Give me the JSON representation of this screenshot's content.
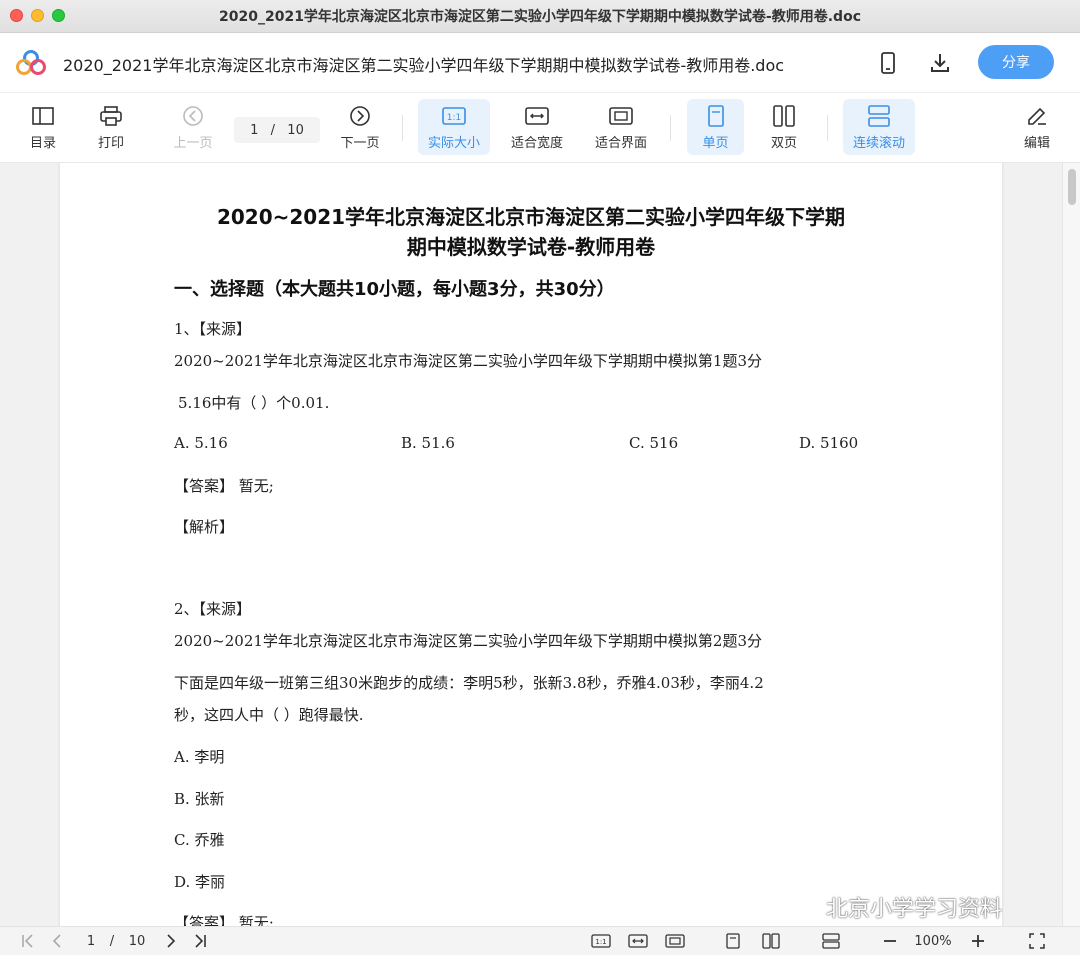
{
  "window": {
    "title": "2020_2021学年北京海淀区北京市海淀区第二实验小学四年级下学期期中模拟数学试卷-教师用卷.doc"
  },
  "header": {
    "doc_title": "2020_2021学年北京海淀区北京市海淀区第二实验小学四年级下学期期中模拟数学试卷-教师用卷.doc",
    "share_label": "分享",
    "accent": "#4d9ef5"
  },
  "toolbar": {
    "toc": "目录",
    "print": "打印",
    "prev": "上一页",
    "current_page": "1",
    "page_sep": "/",
    "total_pages": "10",
    "next": "下一页",
    "actual_size": "实际大小",
    "actual_size_icon": "1:1",
    "fit_width": "适合宽度",
    "fit_screen": "适合界面",
    "single_page": "单页",
    "double_page": "双页",
    "continuous": "连续滚动",
    "edit": "编辑"
  },
  "document": {
    "title_line1": "2020~2021学年北京海淀区北京市海淀区第二实验小学四年级下学期",
    "title_line2": "期中模拟数学试卷-教师用卷",
    "section1": "一、选择题（本大题共10小题，每小题3分，共30分）",
    "q1": {
      "label": "1、【来源】",
      "source": "2020~2021学年北京海淀区北京市海淀区第二实验小学四年级下学期期中模拟第1题3分",
      "stem": "5.16中有（   ）个0.01.",
      "options": [
        "A.  5.16",
        "B.  51.6",
        "C.  516",
        "D.  5160"
      ],
      "answer": "【答案】 暂无;",
      "analysis": "【解析】"
    },
    "q2": {
      "label": "2、【来源】",
      "source": "2020~2021学年北京海淀区北京市海淀区第二实验小学四年级下学期期中模拟第2题3分",
      "stem_line1": "下面是四年级一班第三组30米跑步的成绩：李明5秒，张新3.8秒，乔雅4.03秒，李丽4.2",
      "stem_line2": "秒，这四人中（   ）跑得最快.",
      "options": [
        "A.  李明",
        "B.  张新",
        "C.  乔雅",
        "D.  李丽"
      ],
      "answer_partial": "【答案】 暂无;"
    }
  },
  "watermark": "北京小学学习资料",
  "statusbar": {
    "current_page": "1",
    "page_sep": "/",
    "total_pages": "10",
    "zoom": "100%",
    "actual_size_icon": "1:1"
  }
}
